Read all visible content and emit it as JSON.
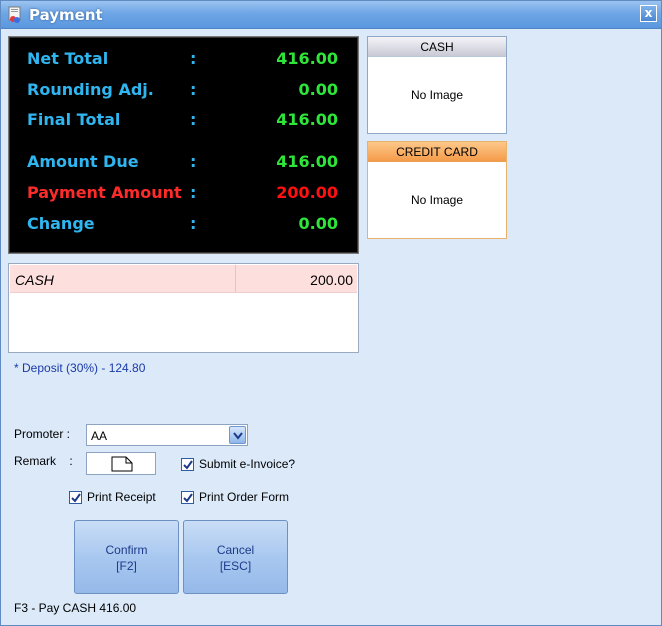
{
  "window": {
    "title": "Payment",
    "close_label": "x"
  },
  "totals": {
    "net_total": {
      "label": "Net Total",
      "value": "416.00"
    },
    "rounding": {
      "label": "Rounding Adj.",
      "value": "0.00"
    },
    "final_total": {
      "label": "Final Total",
      "value": "416.00"
    },
    "amount_due": {
      "label": "Amount Due",
      "value": "416.00"
    },
    "payment_amount": {
      "label": "Payment Amount",
      "value": "200.00"
    },
    "change": {
      "label": "Change",
      "value": "0.00"
    },
    "separator": ":"
  },
  "payment_methods": {
    "cash": {
      "label": "CASH",
      "image_text": "No Image"
    },
    "credit_card": {
      "label": "CREDIT CARD",
      "image_text": "No Image"
    }
  },
  "payment_list": [
    {
      "method": "CASH",
      "amount": "200.00"
    }
  ],
  "deposit_note": "* Deposit (30%) - 124.80",
  "form": {
    "promoter_label": "Promoter :",
    "promoter_value": "AA",
    "remark_label": "Remark    :",
    "submit_einvoice": {
      "label": "Submit e-Invoice?",
      "checked": true
    },
    "print_receipt": {
      "label": "Print Receipt",
      "checked": true
    },
    "print_order_form": {
      "label": "Print Order Form",
      "checked": true
    }
  },
  "buttons": {
    "confirm": {
      "line1": "Confirm",
      "line2": "[F2]"
    },
    "cancel": {
      "line1": "Cancel",
      "line2": "[ESC]"
    }
  },
  "status_text": "F3 - Pay CASH 416.00",
  "colors": {
    "label_blue": "#2fb6f0",
    "value_green": "#2ee63a",
    "payment_red": "#ff1111",
    "panel_bg": "#dbe9f9"
  }
}
